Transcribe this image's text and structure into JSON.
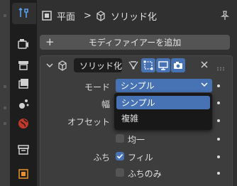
{
  "sidebar_tabs": [
    {
      "name": "tool-icon",
      "active": false
    },
    {
      "name": "render-icon",
      "active": false
    },
    {
      "name": "output-icon",
      "active": false
    },
    {
      "name": "view-layer-icon",
      "active": false
    },
    {
      "name": "scene-icon",
      "active": false
    },
    {
      "name": "world-icon",
      "active": false
    },
    {
      "name": "collection-icon",
      "active": false
    },
    {
      "name": "object-icon",
      "active": false
    },
    {
      "name": "modifier-wrench-icon",
      "active": true
    }
  ],
  "header": {
    "object_name": "平面",
    "separator": ">",
    "modifier_name": "ソリッド化"
  },
  "add_modifier": {
    "label": "モディファイアーを追加"
  },
  "modifier": {
    "name": "ソリッド化",
    "toggles": [
      {
        "name": "edit-mode-toggle",
        "on": false
      },
      {
        "name": "on-cage-toggle",
        "on": true
      },
      {
        "name": "realtime-viewport-toggle",
        "on": true
      },
      {
        "name": "render-toggle",
        "on": true
      }
    ],
    "mode_label": "モード",
    "mode_value": "シンプル",
    "width_label": "幅",
    "offset_label": "オフセット",
    "even_label": "均一",
    "even_checked": false,
    "rim_label": "ふち",
    "fill_label": "フィル",
    "fill_checked": true,
    "rim_only_label": "ふちのみ",
    "rim_only_checked": false
  },
  "mode_menu": {
    "options": [
      "シンプル",
      "複雑"
    ],
    "highlighted": 0
  },
  "colors": {
    "accent": "#4772b3",
    "panel": "#3d3d3d",
    "background": "#303030",
    "tab_bar": "#1d1d1d"
  }
}
